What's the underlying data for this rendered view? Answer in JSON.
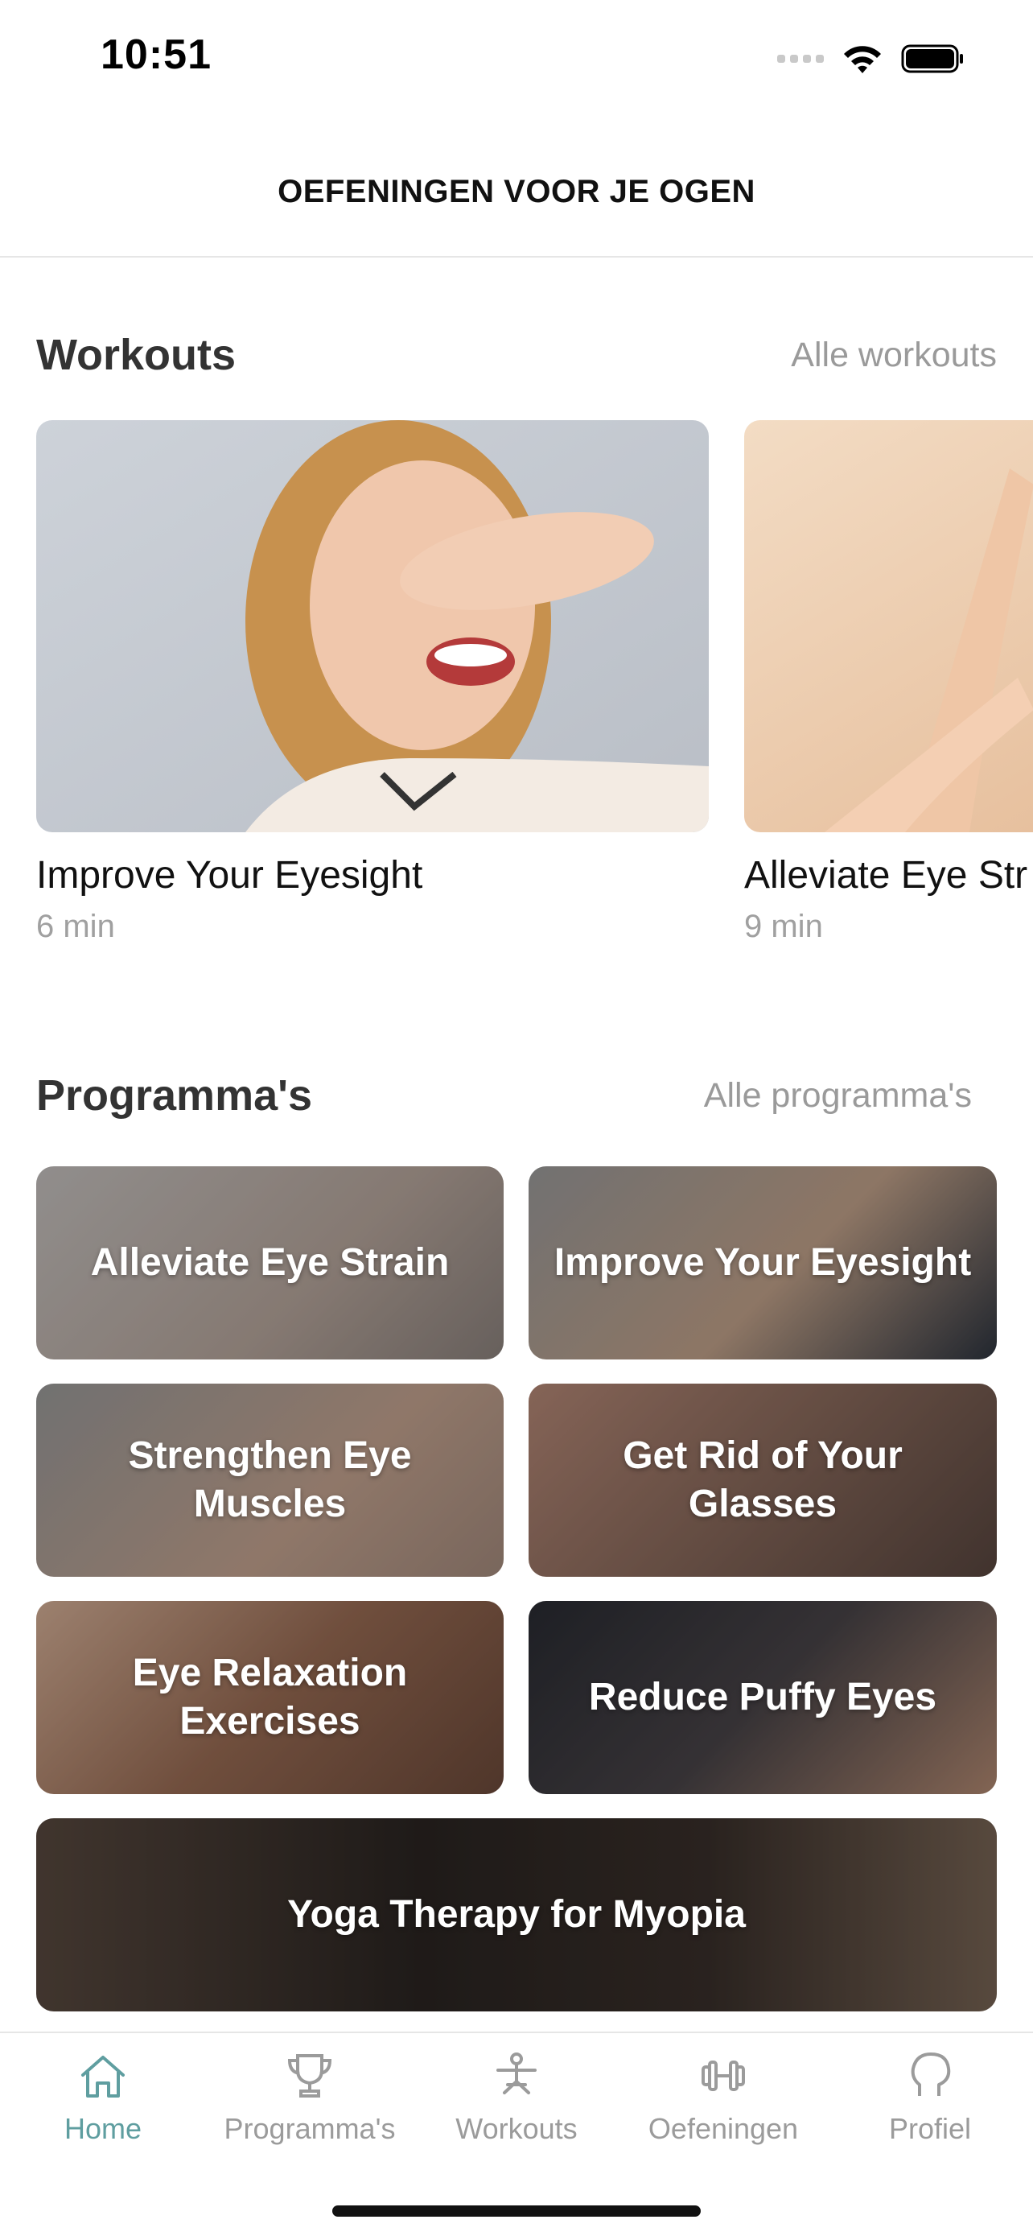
{
  "status": {
    "time": "10:51"
  },
  "header": {
    "title": "OEFENINGEN VOOR JE OGEN"
  },
  "workouts": {
    "title": "Workouts",
    "link": "Alle workouts",
    "items": [
      {
        "name": "Improve Your Eyesight",
        "duration": "6 min"
      },
      {
        "name": "Alleviate Eye Str",
        "duration": "9 min"
      }
    ]
  },
  "programs": {
    "title": "Programma's",
    "link": "Alle programma's",
    "items": [
      {
        "label": "Alleviate Eye Strain"
      },
      {
        "label": "Improve Your Eyesight"
      },
      {
        "label": "Strengthen Eye Muscles"
      },
      {
        "label": "Get Rid of Your Glasses"
      },
      {
        "label": "Eye Relaxation Exercises"
      },
      {
        "label": "Reduce Puffy Eyes"
      },
      {
        "label": "Yoga Therapy for Myopia"
      }
    ]
  },
  "tabbar": {
    "items": [
      {
        "label": "Home",
        "icon": "home-icon",
        "active": true
      },
      {
        "label": "Programma's",
        "icon": "trophy-icon",
        "active": false
      },
      {
        "label": "Workouts",
        "icon": "exercise-figure-icon",
        "active": false
      },
      {
        "label": "Oefeningen",
        "icon": "dumbbell-icon",
        "active": false
      },
      {
        "label": "Profiel",
        "icon": "profile-head-icon",
        "active": false
      }
    ],
    "active_color": "#5f9ea0",
    "inactive_color": "#9b9b9b"
  }
}
